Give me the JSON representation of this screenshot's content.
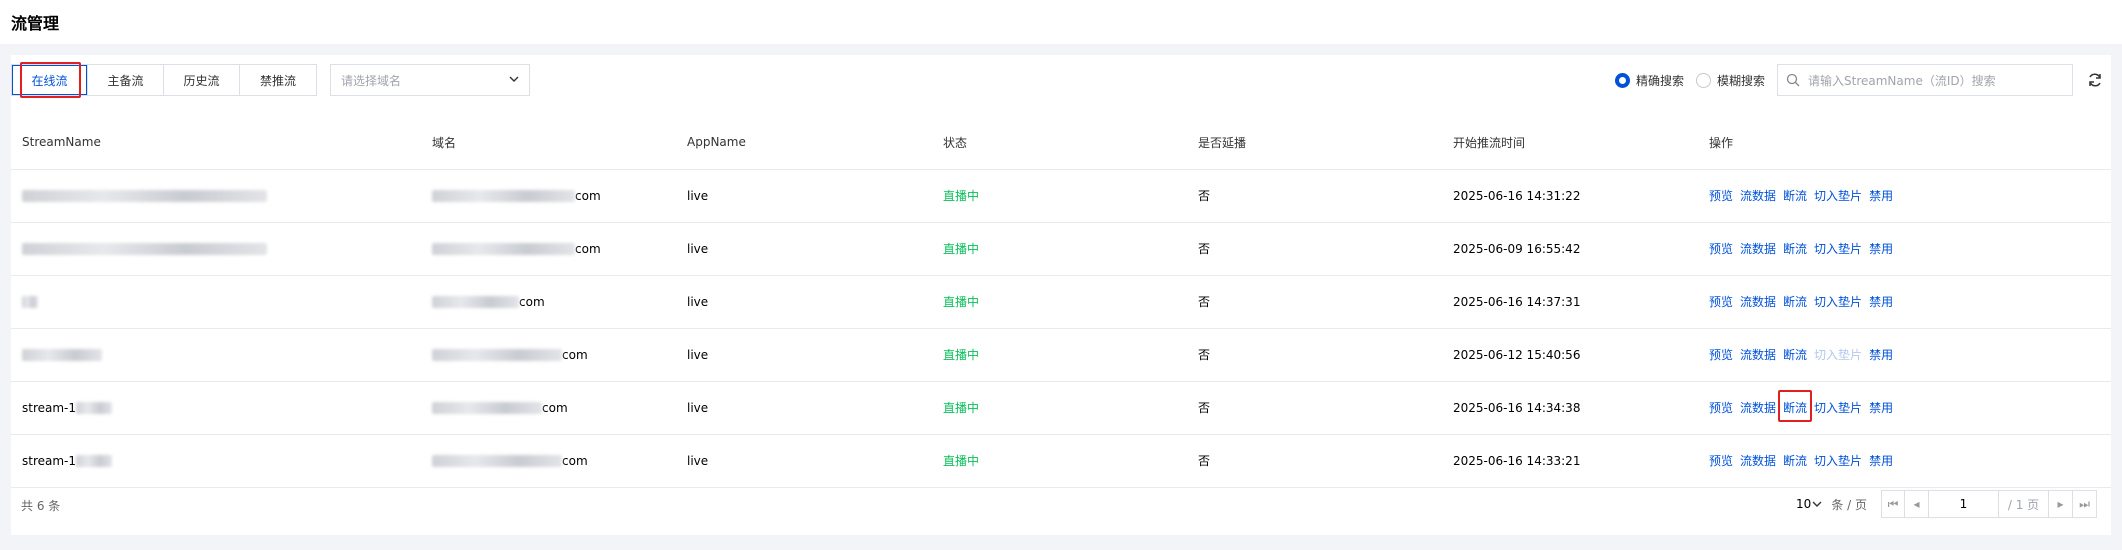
{
  "page": {
    "title": "流管理"
  },
  "tabs": [
    {
      "label": "在线流",
      "active": true
    },
    {
      "label": "主备流",
      "active": false
    },
    {
      "label": "历史流",
      "active": false
    },
    {
      "label": "禁推流",
      "active": false
    }
  ],
  "domain_select": {
    "placeholder": "请选择域名"
  },
  "search_mode": {
    "exact": "精确搜索",
    "fuzzy": "模糊搜索",
    "selected": "exact"
  },
  "search": {
    "placeholder": "请输入StreamName（流ID）搜索"
  },
  "table": {
    "columns": [
      "StreamName",
      "域名",
      "AppName",
      "状态",
      "是否延播",
      "开始推流时间",
      "操作"
    ],
    "rows": [
      {
        "stream": "",
        "domain_suffix": "com",
        "app": "live",
        "status": "直播中",
        "delay": "否",
        "start": "2025-06-16 14:31:22",
        "cut_disabled": false
      },
      {
        "stream": "",
        "domain_suffix": "com",
        "app": "live",
        "status": "直播中",
        "delay": "否",
        "start": "2025-06-09 16:55:42",
        "cut_disabled": false
      },
      {
        "stream": "",
        "domain_suffix": "com",
        "app": "live",
        "status": "直播中",
        "delay": "否",
        "start": "2025-06-16 14:37:31",
        "cut_disabled": false
      },
      {
        "stream": "",
        "domain_suffix": "com",
        "app": "live",
        "status": "直播中",
        "delay": "否",
        "start": "2025-06-12 15:40:56",
        "cut_disabled": true
      },
      {
        "stream": "stream-1",
        "domain_suffix": "com",
        "app": "live",
        "status": "直播中",
        "delay": "否",
        "start": "2025-06-16 14:34:38",
        "cut_disabled": false
      },
      {
        "stream": "stream-1",
        "domain_suffix": "com",
        "app": "live",
        "status": "直播中",
        "delay": "否",
        "start": "2025-06-16 14:33:21",
        "cut_disabled": false
      }
    ],
    "actions": {
      "preview": "预览",
      "data": "流数据",
      "cut": "断流",
      "insert": "切入垫片",
      "ban": "禁用"
    }
  },
  "footer": {
    "total": "共 6 条",
    "page_size": "10",
    "per_page_label": "条 / 页",
    "current_page": "1",
    "total_pages": "/ 1 页"
  },
  "colors": {
    "accent": "#0052d9",
    "live_status": "#0abf5b",
    "highlight": "#e0201f"
  }
}
